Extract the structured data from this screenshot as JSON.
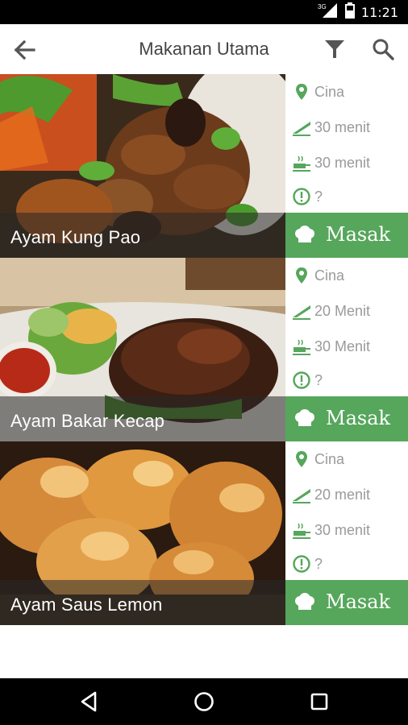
{
  "status_bar": {
    "network": "3G",
    "time": "11:21"
  },
  "app_bar": {
    "title": "Makanan Utama"
  },
  "recipes": [
    {
      "name": "Ayam Kung Pao",
      "cuisine": "Cina",
      "prep_time": "30 menit",
      "cook_time": "30 menit",
      "difficulty": "?",
      "action": "Masak"
    },
    {
      "name": "Ayam Bakar Kecap",
      "cuisine": "Cina",
      "prep_time": "20 Menit",
      "cook_time": "30 Menit",
      "difficulty": "?",
      "action": "Masak"
    },
    {
      "name": "Ayam Saus Lemon",
      "cuisine": "Cina",
      "prep_time": "20 menit",
      "cook_time": "30 menit",
      "difficulty": "?",
      "action": "Masak"
    }
  ],
  "colors": {
    "accent": "#56a65b",
    "text_secondary": "#9a9a9a"
  }
}
